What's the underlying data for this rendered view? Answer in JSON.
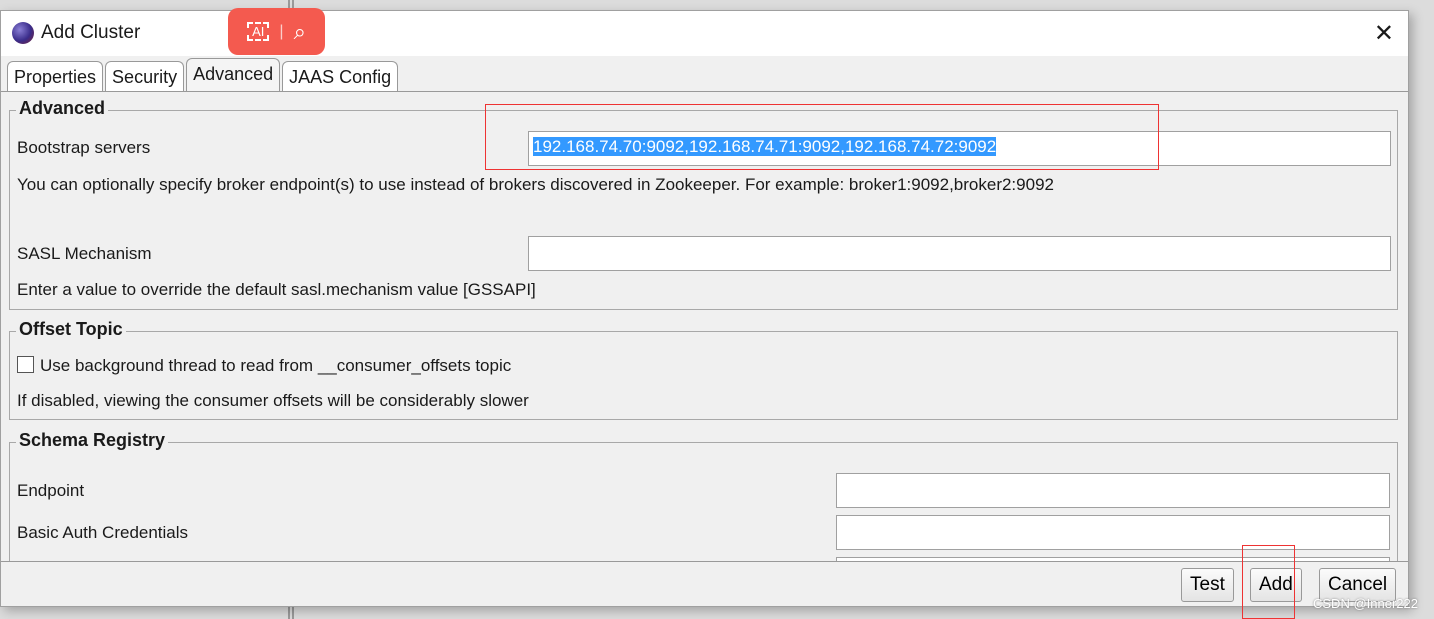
{
  "window": {
    "title": "Add Cluster",
    "close": "✕"
  },
  "overlay": {
    "ai": "AI",
    "search": "⌕"
  },
  "tabs": [
    {
      "label": "Properties"
    },
    {
      "label": "Security"
    },
    {
      "label": "Advanced",
      "active": true
    },
    {
      "label": "JAAS Config"
    }
  ],
  "advanced": {
    "title": "Advanced",
    "bootstrap_label": "Bootstrap servers",
    "bootstrap_value": "192.168.74.70:9092,192.168.74.71:9092,192.168.74.72:9092",
    "bootstrap_help": "You can optionally specify broker endpoint(s) to use instead of brokers discovered in Zookeeper. For example: broker1:9092,broker2:9092",
    "sasl_label": "SASL Mechanism",
    "sasl_value": "",
    "sasl_help": "Enter a value to override the default sasl.mechanism value [GSSAPI]"
  },
  "offset": {
    "title": "Offset Topic",
    "checkbox_label": "Use background thread to read from __consumer_offsets topic",
    "checked": false,
    "help": "If disabled, viewing the consumer offsets will be considerably slower"
  },
  "schema": {
    "title": "Schema Registry",
    "endpoint_label": "Endpoint",
    "endpoint_value": "",
    "auth_label": "Basic Auth Credentials",
    "auth_value": ""
  },
  "buttons": {
    "test": "Test",
    "add": "Add",
    "cancel": "Cancel"
  },
  "watermark": "CSDN @Inner222",
  "colors": {
    "selection": "#3399ff",
    "overlay": "#f45a4f",
    "highlight_box": "#e33333"
  }
}
